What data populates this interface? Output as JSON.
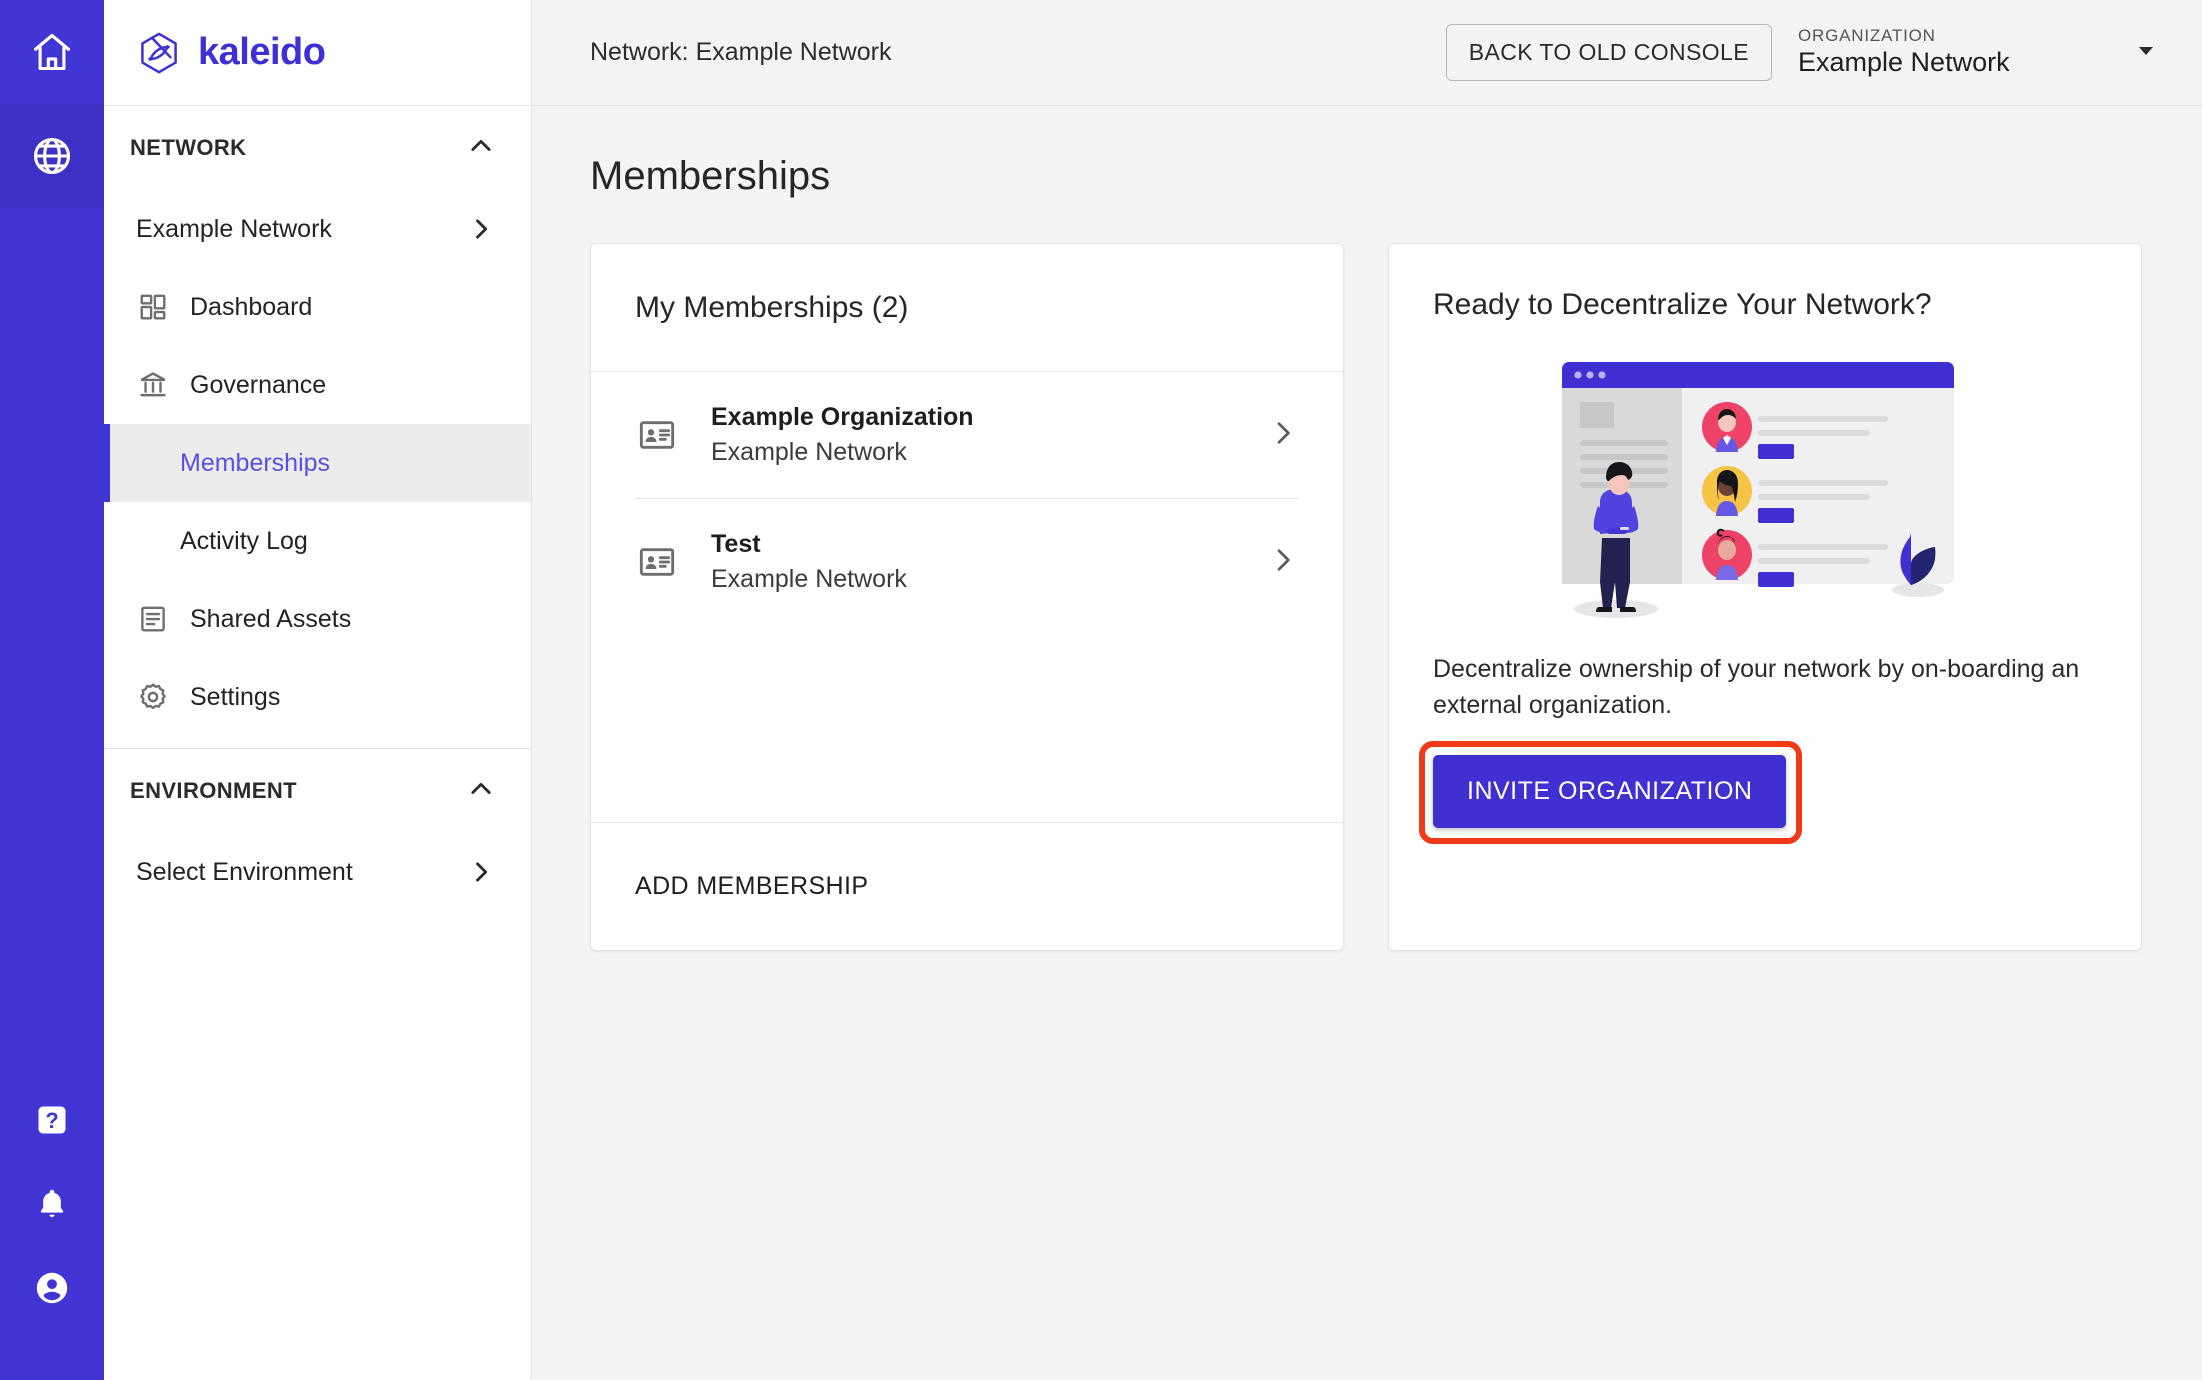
{
  "brand": {
    "name": "kaleido",
    "accent": "#4135D4",
    "active_text": "#5B4FE3",
    "highlight": "#F03A17"
  },
  "rail": {
    "items": [
      {
        "icon": "home-icon",
        "name": "home",
        "selected": false
      },
      {
        "icon": "globe-icon",
        "name": "networks",
        "selected": true
      }
    ],
    "bottom_items": [
      {
        "icon": "help-icon",
        "name": "help"
      },
      {
        "icon": "bell-icon",
        "name": "notifications"
      },
      {
        "icon": "account-icon",
        "name": "account"
      }
    ]
  },
  "sidebar": {
    "sections": [
      {
        "title": "NETWORK",
        "collapse_icon": "chevron-up-icon",
        "items": [
          {
            "label": "Example Network",
            "icon": null,
            "trailing": "chevron-right-icon",
            "active": false,
            "indent": false
          },
          {
            "label": "Dashboard",
            "icon": "dashboard-icon",
            "trailing": null,
            "active": false,
            "indent": false
          },
          {
            "label": "Governance",
            "icon": "governance-icon",
            "trailing": null,
            "active": false,
            "indent": false
          },
          {
            "label": "Memberships",
            "icon": null,
            "trailing": null,
            "active": true,
            "indent": true
          },
          {
            "label": "Activity Log",
            "icon": null,
            "trailing": null,
            "active": false,
            "indent": true
          },
          {
            "label": "Shared Assets",
            "icon": "shared-assets-icon",
            "trailing": null,
            "active": false,
            "indent": false
          },
          {
            "label": "Settings",
            "icon": "settings-icon",
            "trailing": null,
            "active": false,
            "indent": false
          }
        ]
      },
      {
        "title": "ENVIRONMENT",
        "collapse_icon": "chevron-up-icon",
        "items": [
          {
            "label": "Select Environment",
            "icon": null,
            "trailing": "chevron-right-icon",
            "active": false,
            "indent": false
          }
        ]
      }
    ]
  },
  "topbar": {
    "network_label": "Network: Example Network",
    "back_to_old_console": "BACK TO OLD CONSOLE",
    "org_label": "ORGANIZATION",
    "org_value": "Example Network",
    "org_caret": "caret-down-icon"
  },
  "page": {
    "title": "Memberships"
  },
  "memberships_card": {
    "heading": "My Memberships (2)",
    "items": [
      {
        "title": "Example Organization",
        "subtitle": "Example Network",
        "icon": "contact-card-icon",
        "caret": "chevron-right-icon"
      },
      {
        "title": "Test",
        "subtitle": "Example Network",
        "icon": "contact-card-icon",
        "caret": "chevron-right-icon"
      }
    ],
    "footer_action": "ADD MEMBERSHIP"
  },
  "promo_card": {
    "title": "Ready to Decentralize Your Network?",
    "description": "Decentralize ownership of your network by on-boarding an external organization.",
    "cta_label": "INVITE ORGANIZATION",
    "cta_highlighted": true,
    "illustration": {
      "name": "decentralize-illustration",
      "window_bar_color": "#4030D1",
      "avatar_colors": [
        "#EE4266",
        "#F6C344",
        "#EE4266"
      ],
      "leaf_colors": [
        "#4030D1",
        "#252470"
      ]
    }
  }
}
